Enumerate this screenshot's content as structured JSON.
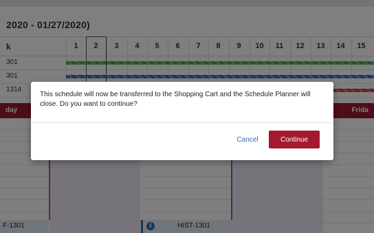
{
  "background": {
    "date_range": "2020 - 01/27/2020)",
    "header_first_label": "k",
    "column_numbers": [
      "1",
      "2",
      "3",
      "4",
      "5",
      "6",
      "7",
      "8",
      "9",
      "10",
      "11",
      "12",
      "13",
      "14",
      "15"
    ],
    "course_rows": [
      {
        "label": "301",
        "bar_color": "green"
      },
      {
        "label": "301",
        "bar_color": "blue"
      },
      {
        "label": "1314",
        "bar_color": "red"
      }
    ],
    "day_left": "day",
    "day_right": "Frida",
    "blocks": [
      {
        "title": "F-1301"
      },
      {
        "title": "HIST-1301",
        "icon": "info-icon"
      }
    ]
  },
  "dialog": {
    "message": "This schedule will now be transferred to the Shopping Cart and the Schedule Planner will close. Do you want to continue?",
    "cancel_label": "Cancel",
    "continue_label": "Continue"
  },
  "colors": {
    "brand_red": "#a31a2f",
    "link_blue": "#3066b0",
    "green_bar": "#3ea84b",
    "blue_bar": "#3a67c2",
    "red_bar": "#c23a3a",
    "purple_accent": "#8e57b5"
  }
}
